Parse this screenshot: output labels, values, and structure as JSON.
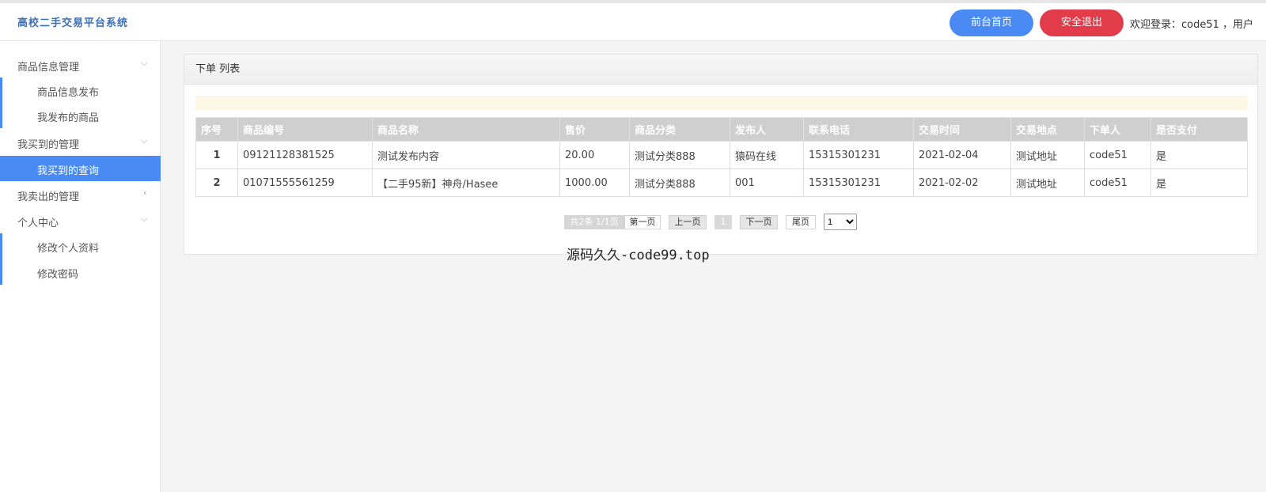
{
  "header": {
    "brand": "高校二手交易平台系统",
    "home_button": "前台首页",
    "logout_button": "安全退出",
    "welcome": "欢迎登录：code51 ，用户"
  },
  "sidebar": {
    "groups": [
      {
        "label": "商品信息管理",
        "items": [
          "商品信息发布",
          "我发布的商品"
        ]
      },
      {
        "label": "我买到的管理",
        "items": [
          "我买到的查询"
        ]
      },
      {
        "label": "我卖出的管理",
        "items": []
      },
      {
        "label": "个人中心",
        "items": [
          "修改个人资料",
          "修改密码"
        ]
      }
    ]
  },
  "panel": {
    "title": "下单 列表"
  },
  "table": {
    "columns": [
      "序号",
      "商品编号",
      "商品名称",
      "售价",
      "商品分类",
      "发布人",
      "联系电话",
      "交易时间",
      "交易地点",
      "下单人",
      "是否支付"
    ],
    "rows": [
      [
        "1",
        "09121128381525",
        "测试发布内容",
        "20.00",
        "测试分类888",
        "猿码在线",
        "15315301231",
        "2021-02-04",
        "测试地址",
        "code51",
        "是"
      ],
      [
        "2",
        "01071555561259",
        "【二手95新】神舟/Hasee",
        "1000.00",
        "测试分类888",
        "001",
        "15315301231",
        "2021-02-02",
        "测试地址",
        "code51",
        "是"
      ]
    ]
  },
  "pager": {
    "info": "共2条 1/1页",
    "first": "第一页",
    "prev": "上一页",
    "current": "1",
    "next": "下一页",
    "last": "尾页",
    "select_value": "1"
  },
  "watermark": "源码久久-code99.top",
  "colors": {
    "accent": "#4a8af4",
    "danger": "#e23b4a",
    "brand_text": "#3c6fb5"
  }
}
